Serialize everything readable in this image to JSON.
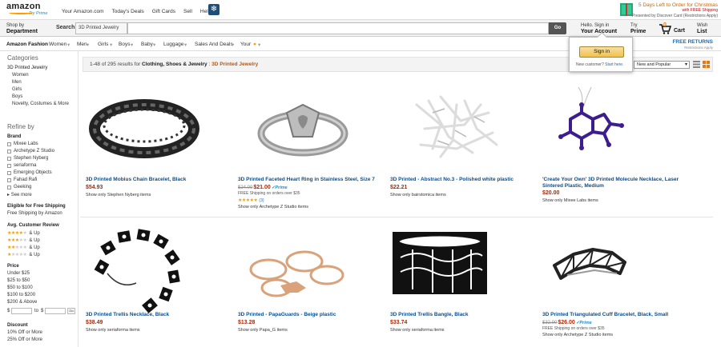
{
  "header": {
    "logo_text": "amazon",
    "logo_sub": "Try Prime",
    "links": [
      "Your Amazon.com",
      "Today's Deals",
      "Gift Cards",
      "Sell",
      "Help"
    ],
    "promo": {
      "line1": "5 Days Left to Order for Christmas",
      "line2": "with FREE Shipping",
      "line3": "Presented by Discover Card (Restrictions Apply)"
    }
  },
  "searchbar": {
    "shop_by_l1": "Shop by",
    "shop_by_l2": "Department",
    "search_label": "Search",
    "dept_value": "3D Printed Jewelry",
    "query": "",
    "go_label": "Go",
    "account_l1": "Hello. Sign in",
    "account_l2": "Your Account",
    "prime_l1": "Try",
    "prime_l2": "Prime",
    "cart_count": "0",
    "cart_label": "Cart",
    "wish_l1": "Wish",
    "wish_l2": "List"
  },
  "nav": {
    "items": [
      "Amazon Fashion",
      "Women",
      "Men",
      "Girls",
      "Boys",
      "Baby",
      "Luggage",
      "Sales And Deals",
      "Your"
    ],
    "free_returns": "FREE RETURNS",
    "free_returns_sub": "Restrictions Apply"
  },
  "popover": {
    "signin_label": "Sign in",
    "new_customer": "New customer?",
    "start_here": "Start here."
  },
  "sidebar": {
    "categories_heading": "Categories",
    "category_current": "3D Printed Jewelry",
    "subcategories": [
      "Women",
      "Men",
      "Girls",
      "Boys",
      "Novelty, Costumes & More"
    ],
    "refine_heading": "Refine by",
    "brand_heading": "Brand",
    "brands": [
      "Mixee Labs",
      "Archetype Z Studio",
      "Stephen Nyberg",
      "seriaforma",
      "Emerging Objects",
      "Fahad Rafi",
      "Geeking"
    ],
    "see_more": "See more",
    "free_ship_heading": "Eligible for Free Shipping",
    "free_ship_item": "Free Shipping by Amazon",
    "review_heading": "Avg. Customer Review",
    "review_labels": [
      "& Up",
      "& Up",
      "& Up",
      "& Up"
    ],
    "review_stars": [
      4,
      3,
      2,
      1
    ],
    "price_heading": "Price",
    "price_ranges": [
      "Under $25",
      "$25 to $50",
      "$50 to $100",
      "$100 to $200",
      "$200 & Above"
    ],
    "price_min_prefix": "$",
    "price_to": "to",
    "price_max_prefix": "$",
    "price_go": "Go",
    "discount_heading": "Discount",
    "discounts": [
      "10% Off or More",
      "25% Off or More"
    ]
  },
  "results": {
    "count_text": "1-48 of 295 results for",
    "scope": "Clothing, Shoes & Jewelry",
    "separator": ":",
    "query": "3D Printed Jewelry",
    "sort_value": "New and Popular"
  },
  "products": [
    {
      "title": "3D Printed Mobius Chain Bracelet, Black",
      "old_price": "",
      "price": "$54.93",
      "prime": "",
      "ship": "",
      "stars": 0,
      "reviews": "",
      "only": "Show only Stephen Nyberg items",
      "image": "mobius-bracelet"
    },
    {
      "title": "3D Printed Faceted Heart Ring in Stainless Steel, Size 7",
      "old_price": "$24.00",
      "price": "$21.00",
      "prime": "✓Prime",
      "ship": "FREE Shipping on orders over $35",
      "stars": 5,
      "reviews": "(3)",
      "only": "Show only Archetype Z Studio items",
      "image": "heart-ring"
    },
    {
      "title": "3D Printed - Abstract No.3 - Polished white plastic",
      "old_price": "",
      "price": "$22.21",
      "prime": "",
      "ship": "",
      "stars": 0,
      "reviews": "",
      "only": "Show only bairstomica items",
      "image": "abstract-white"
    },
    {
      "title": "'Create Your Own' 3D Printed Molecule Necklace, Laser Sintered Plastic, Medium",
      "old_price": "",
      "price": "$20.00",
      "prime": "",
      "ship": "",
      "stars": 0,
      "reviews": "",
      "only": "Show only Mixee Labs items",
      "image": "molecule-necklace"
    },
    {
      "title": "3D Printed Trellis Necklace, Black",
      "old_price": "",
      "price": "$38.49",
      "prime": "",
      "ship": "",
      "stars": 0,
      "reviews": "",
      "only": "Show only seriaforma items",
      "image": "trellis-necklace"
    },
    {
      "title": "3D Printed - PapaGuards - Beige plastic",
      "old_price": "",
      "price": "$13.28",
      "prime": "",
      "ship": "",
      "stars": 0,
      "reviews": "",
      "only": "Show only Papa_G items",
      "image": "papaguards"
    },
    {
      "title": "3D Printed Trellis Bangle, Black",
      "old_price": "",
      "price": "$33.74",
      "prime": "",
      "ship": "",
      "stars": 0,
      "reviews": "",
      "only": "Show only seriaforma items",
      "image": "trellis-bangle"
    },
    {
      "title": "3D Printed Triangulated Cuff Bracelet, Black, Small",
      "old_price": "$32.00",
      "price": "$26.00",
      "prime": "✓Prime",
      "ship": "FREE Shipping on orders over $35",
      "stars": 0,
      "reviews": "",
      "only": "Show only Archetype Z Studio items",
      "image": "cuff-bracelet"
    }
  ],
  "colors": {
    "link": "#0a4d8c",
    "price": "#b12704",
    "accent": "#f90",
    "prime": "#1a8fc9"
  }
}
